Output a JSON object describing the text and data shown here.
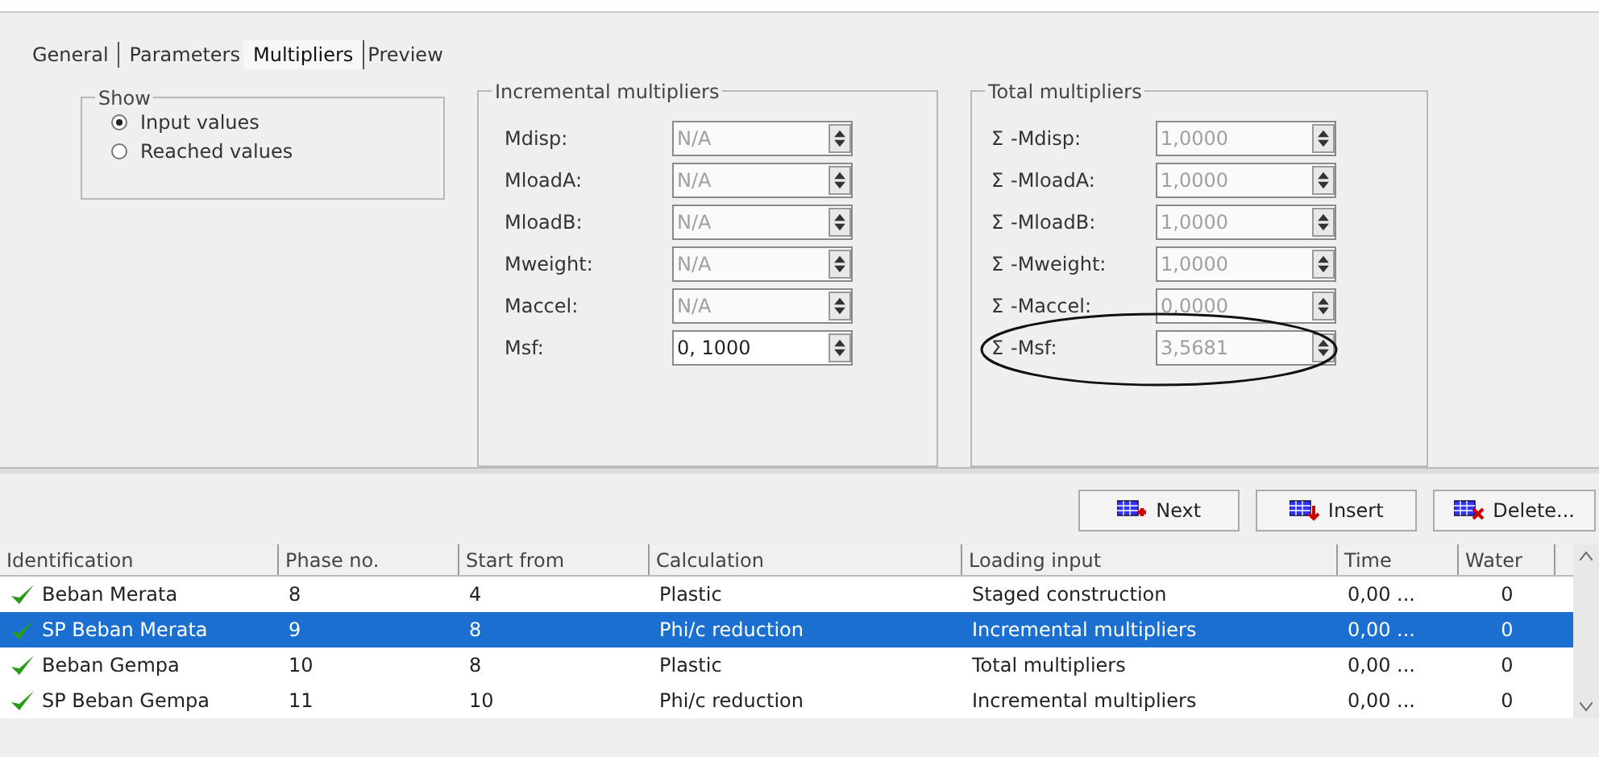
{
  "tabs": [
    {
      "label": "General",
      "selected": false
    },
    {
      "label": "Parameters",
      "selected": false
    },
    {
      "label": "Multipliers",
      "selected": true
    },
    {
      "label": "Preview",
      "selected": false
    }
  ],
  "show": {
    "title": "Show",
    "options": [
      {
        "label": "Input values",
        "selected": true
      },
      {
        "label": "Reached values",
        "selected": false
      }
    ]
  },
  "incremental": {
    "title": "Incremental multipliers",
    "fields": [
      {
        "label": "Mdisp:",
        "value": "N/A",
        "disabled": true
      },
      {
        "label": "MloadA:",
        "value": "N/A",
        "disabled": true
      },
      {
        "label": "MloadB:",
        "value": "N/A",
        "disabled": true
      },
      {
        "label": "Mweight:",
        "value": "N/A",
        "disabled": true
      },
      {
        "label": "Maccel:",
        "value": "N/A",
        "disabled": true
      },
      {
        "label": "Msf:",
        "value": "0, 1000",
        "disabled": false
      }
    ]
  },
  "total": {
    "title": "Total multipliers",
    "fields": [
      {
        "symbol": "Σ",
        "label": "-Mdisp:",
        "value": "1,0000",
        "disabled": true,
        "circled": false
      },
      {
        "symbol": "Σ",
        "label": "-MloadA:",
        "value": "1,0000",
        "disabled": true,
        "circled": false
      },
      {
        "symbol": "Σ",
        "label": "-MloadB:",
        "value": "1,0000",
        "disabled": true,
        "circled": false
      },
      {
        "symbol": "Σ",
        "label": "-Mweight:",
        "value": "1,0000",
        "disabled": true,
        "circled": false
      },
      {
        "symbol": "Σ",
        "label": "-Maccel:",
        "value": "0,0000",
        "disabled": true,
        "circled": false
      },
      {
        "symbol": "Σ",
        "label": "-Msf:",
        "value": "3,5681",
        "disabled": true,
        "circled": true
      }
    ]
  },
  "buttons": [
    {
      "label": "Next",
      "kind": "next"
    },
    {
      "label": "Insert",
      "kind": "insert"
    },
    {
      "label": "Delete...",
      "kind": "delete"
    }
  ],
  "table": {
    "columns": [
      "Identification",
      "Phase no.",
      "Start from",
      "Calculation",
      "Loading input",
      "Time",
      "Water"
    ],
    "rows": [
      {
        "selected": false,
        "cells": [
          "Beban Merata",
          "8",
          "4",
          "Plastic",
          "Staged construction",
          "0,00 ...",
          "0"
        ]
      },
      {
        "selected": true,
        "cells": [
          "SP Beban Merata",
          "9",
          "8",
          "Phi/c reduction",
          "Incremental multipliers",
          "0,00 ...",
          "0"
        ]
      },
      {
        "selected": false,
        "cells": [
          "Beban Gempa",
          "10",
          "8",
          "Plastic",
          "Total multipliers",
          "0,00 ...",
          "0"
        ]
      },
      {
        "selected": false,
        "cells": [
          "SP Beban Gempa",
          "11",
          "10",
          "Phi/c reduction",
          "Incremental multipliers",
          "0,00 ...",
          "0"
        ]
      }
    ]
  }
}
